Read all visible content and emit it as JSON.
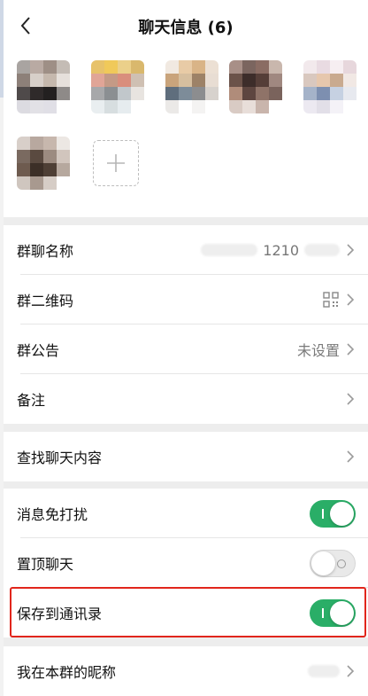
{
  "header": {
    "title": "聊天信息 (6)"
  },
  "members": {
    "avatars": [
      [
        "#a9a4a1",
        "#b9aaa3",
        "#9e8f86",
        "#c4bcb5",
        "#8d8079",
        "#d7cfc9",
        "#c5b8ad",
        "#e6e0db",
        "#4f4a4a",
        "#2f2a2a",
        "#232020",
        "#8e8a88",
        "#dcdbe1",
        "#e2e1e6",
        "#e0dfe6",
        "#ffffff"
      ],
      [
        "#e7c26a",
        "#f0c95a",
        "#ebd08a",
        "#d9b86d",
        "#e0a597",
        "#c49a86",
        "#d98e7d",
        "#cfc0b3",
        "#a7a8aa",
        "#8b8f92",
        "#c1c7cb",
        "#e8e4e0",
        "#e9eef0",
        "#d7dee0",
        "#e6ecef",
        "#ffffff"
      ],
      [
        "#f1e9e1",
        "#e8cba6",
        "#d9b487",
        "#ece0d4",
        "#c9a47c",
        "#d6bf9f",
        "#9d8267",
        "#e8ddd3",
        "#5f6e7d",
        "#7d8c99",
        "#8c8d8f",
        "#d7d2cd",
        "#ebe9e7",
        "#ffffff",
        "#f4f3f2",
        "#ffffff"
      ],
      [
        "#a88f87",
        "#7b655f",
        "#8a6c63",
        "#c9b7ad",
        "#6b5249",
        "#3d2d2a",
        "#553e38",
        "#a08880",
        "#b08c7a",
        "#5e4640",
        "#8f7368",
        "#7a635c",
        "#d9cbc4",
        "#e8ded9",
        "#c9b5ac",
        "#ffffff"
      ],
      [
        "#f2e9ec",
        "#e9dbe2",
        "#f6eef1",
        "#e7d7dc",
        "#d9c8bf",
        "#e6c7ad",
        "#c9aa8f",
        "#f1e8e4",
        "#a5b3c9",
        "#7d8fb0",
        "#c6d1e2",
        "#e7e9ef",
        "#ece9f1",
        "#e2dfe8",
        "#f4f2f7",
        "#ffffff"
      ],
      [
        "#d8cfc9",
        "#b8a89f",
        "#c7b7ad",
        "#ece7e3",
        "#7a6a60",
        "#5a4a40",
        "#9c8b80",
        "#d1c5bd",
        "#6e5b4f",
        "#3c2f27",
        "#4e3f35",
        "#b6a89e",
        "#cfc6bf",
        "#a8998f",
        "#d6cdc6",
        "#ffffff"
      ]
    ]
  },
  "rows": [
    {
      "label": "群聊名称",
      "value": "1210"
    },
    {
      "label": "群二维码"
    },
    {
      "label": "群公告",
      "value": "未设置"
    },
    {
      "label": "备注"
    },
    {
      "label": "查找聊天内容"
    },
    {
      "label": "消息免打扰",
      "toggle": true
    },
    {
      "label": "置顶聊天",
      "toggle": false
    },
    {
      "label": "保存到通讯录",
      "toggle": true
    },
    {
      "label": "我在本群的昵称"
    }
  ]
}
